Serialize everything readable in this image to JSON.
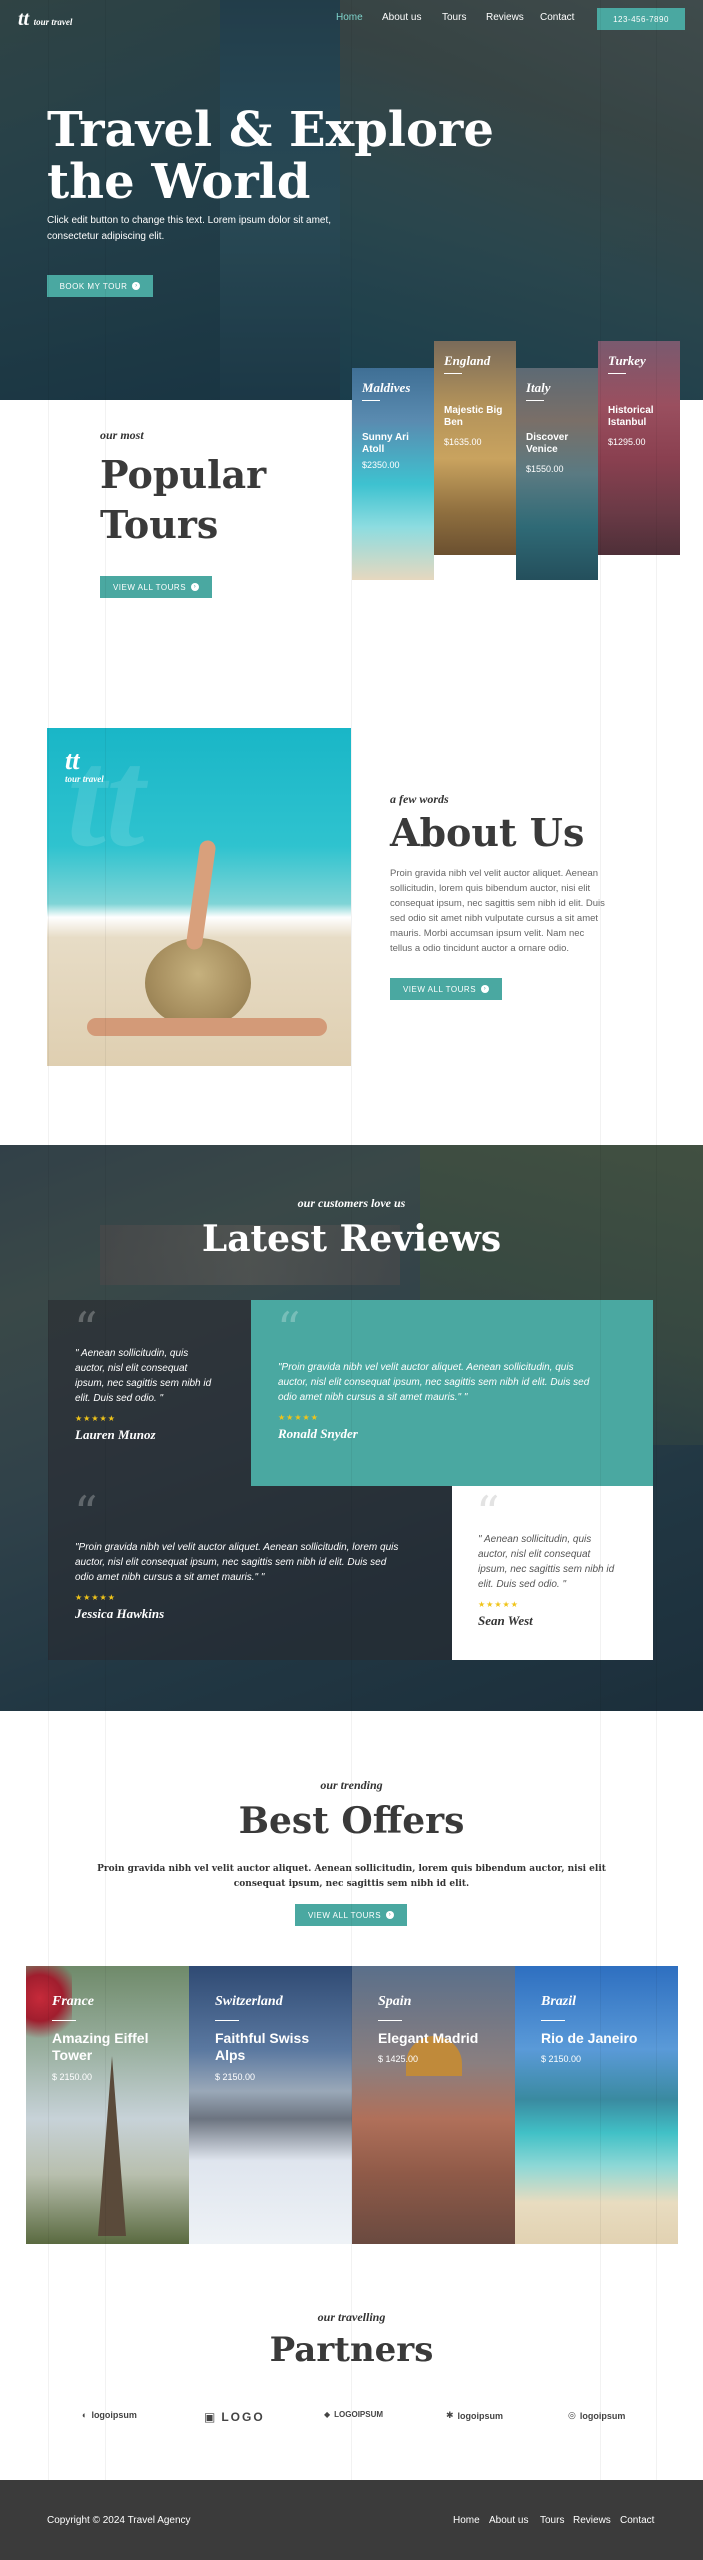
{
  "header": {
    "logo_mark": "tt",
    "logo_text": "tour travel",
    "nav": [
      "Home",
      "About us",
      "Tours",
      "Reviews",
      "Contact"
    ],
    "phone": "123-456-7890"
  },
  "hero": {
    "title_line1": "Travel & Explore",
    "title_line2": "the World",
    "subtitle_line1": "Click edit button to change this text. Lorem ipsum dolor sit amet,",
    "subtitle_line2": "consectetur adipiscing elit.",
    "button": "BOOK MY TOUR"
  },
  "popular": {
    "kicker": "our most",
    "title_line1": "Popular",
    "title_line2": "Tours",
    "button": "VIEW ALL TOURS",
    "tours": [
      {
        "country": "Maldives",
        "title": "Sunny Ari Atoll",
        "price": "$2350.00"
      },
      {
        "country": "England",
        "title": "Majestic Big Ben",
        "price": "$1635.00"
      },
      {
        "country": "Italy",
        "title": "Discover Venice",
        "price": "$1550.00"
      },
      {
        "country": "Turkey",
        "title": "Historical Istanbul",
        "price": "$1295.00"
      }
    ]
  },
  "about": {
    "logo_mark": "tt",
    "logo_text": "tour travel",
    "kicker": "a few words",
    "title": "About Us",
    "body_lines": [
      "Proin gravida nibh vel velit auctor aliquet. Aenean",
      "sollicitudin, lorem quis bibendum auctor, nisi elit",
      "consequat ipsum, nec sagittis sem nibh id elit. Duis",
      "sed odio sit amet nibh vulputate cursus a sit amet",
      "mauris. Morbi accumsan ipsum velit. Nam nec",
      "tellus a odio tincidunt auctor a ornare odio."
    ],
    "button": "VIEW ALL TOURS"
  },
  "reviews": {
    "kicker": "our customers love us",
    "title": "Latest Reviews",
    "items": [
      {
        "lines": [
          "\" Aenean sollicitudin, quis",
          "auctor, nisl elit consequat",
          "ipsum, nec sagittis sem nibh id",
          "elit. Duis sed odio. \""
        ],
        "stars": "★★★★★",
        "name": "Lauren Munoz"
      },
      {
        "lines": [
          "\"Proin gravida nibh vel velit auctor aliquet. Aenean sollicitudin, quis",
          "auctor, nisl elit consequat ipsum, nec sagittis sem nibh id elit. Duis sed",
          "odio amet nibh cursus a sit amet mauris.\" \""
        ],
        "stars": "★★★★★",
        "name": "Ronald Snyder"
      },
      {
        "lines": [
          "\"Proin gravida nibh vel velit auctor aliquet. Aenean sollicitudin, lorem quis",
          "auctor, nisl elit consequat ipsum, nec sagittis sem nibh id elit. Duis sed",
          "odio amet nibh cursus a sit amet mauris.\" \""
        ],
        "stars": "★★★★★",
        "name": "Jessica Hawkins"
      },
      {
        "lines": [
          "\" Aenean sollicitudin, quis",
          "auctor, nisl elit consequat",
          "ipsum, nec sagittis sem nibh id",
          "elit. Duis sed odio. \""
        ],
        "stars": "★★★★★",
        "name": "Sean West"
      }
    ]
  },
  "offers": {
    "kicker": "our trending",
    "title": "Best Offers",
    "body_line1": "Proin gravida nibh vel velit auctor aliquet. Aenean sollicitudin, lorem quis bibendum auctor, nisi elit",
    "body_line2": "consequat ipsum, nec sagittis sem nibh id elit.",
    "button": "VIEW ALL TOURS",
    "items": [
      {
        "country": "France",
        "title": "Amazing Eiffel Tower",
        "price": "$ 2150.00"
      },
      {
        "country": "Switzerland",
        "title": "Faithful Swiss Alps",
        "price": "$ 2150.00"
      },
      {
        "country": "Spain",
        "title": "Elegant Madrid",
        "price": "$ 1425.00"
      },
      {
        "country": "Brazil",
        "title": "Rio de Janeiro",
        "price": "$ 2150.00"
      }
    ]
  },
  "partners": {
    "kicker": "our travelling",
    "title": "Partners",
    "logos": [
      "logoipsum",
      "LOGO",
      "LOGOIPSUM",
      "logoipsum",
      "logoipsum"
    ]
  },
  "footer": {
    "copyright": "Copyright © 2024 Travel Agency",
    "links": [
      "Home",
      "About us",
      "Tours",
      "Reviews",
      "Contact"
    ]
  },
  "colors": {
    "accent": "#4aa8a1",
    "dark": "#3a3a3a",
    "footer": "#3b3b3b"
  }
}
